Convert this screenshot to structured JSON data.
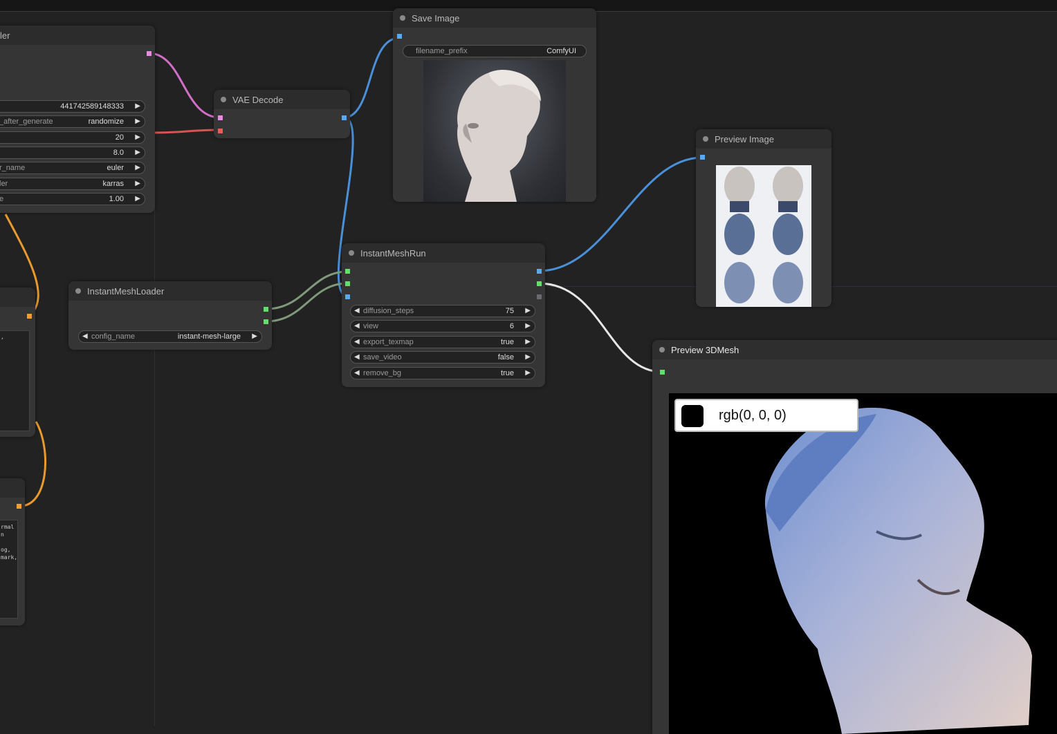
{
  "colors": {
    "canvas": "#222222",
    "node_body": "#353535",
    "node_header": "#2c2c2c",
    "link_image": "#4a90d9",
    "link_latent": "#d16ec8",
    "link_vae": "#d9534f",
    "link_clip": "#e89a2c",
    "link_green": "#7f9a7a",
    "link_white": "#e6e6e6"
  },
  "ksampler": {
    "title_fragment": "ler",
    "widgets": [
      {
        "label": "",
        "value": "441742589148333"
      },
      {
        "label": "_after_generate",
        "value": "randomize"
      },
      {
        "label": "",
        "value": "20"
      },
      {
        "label": "",
        "value": "8.0"
      },
      {
        "label": "r_name",
        "value": "euler"
      },
      {
        "label": "ler",
        "value": "karras"
      },
      {
        "label": "e",
        "value": "1.00"
      }
    ]
  },
  "vae_decode": {
    "title": "VAE Decode"
  },
  "save_image": {
    "title": "Save Image",
    "widget_label": "filename_prefix",
    "widget_value": "ComfyUI",
    "image_icon": "bust-render-image"
  },
  "preview_image": {
    "title": "Preview Image",
    "image_icon": "multiview-grid-image"
  },
  "instant_mesh_run": {
    "title": "InstantMeshRun",
    "widgets": [
      {
        "label": "diffusion_steps",
        "value": "75"
      },
      {
        "label": "view",
        "value": "6"
      },
      {
        "label": "export_texmap",
        "value": "true"
      },
      {
        "label": "save_video",
        "value": "false"
      },
      {
        "label": "remove_bg",
        "value": "true"
      }
    ]
  },
  "instant_mesh_loader": {
    "title": "InstantMeshLoader",
    "widget_label": "config_name",
    "widget_value": "instant-mesh-large"
  },
  "preview_3dmesh": {
    "title": "Preview 3DMesh",
    "bg_color_label": "rgb(0, 0, 0)",
    "viewport_icon": "3d-mesh-viewport"
  },
  "left_textarea_1": {
    "lines": [
      ","
    ]
  },
  "left_textarea_2": {
    "lines": [
      "rmal",
      "n",
      "",
      "og,",
      "mark,"
    ]
  }
}
